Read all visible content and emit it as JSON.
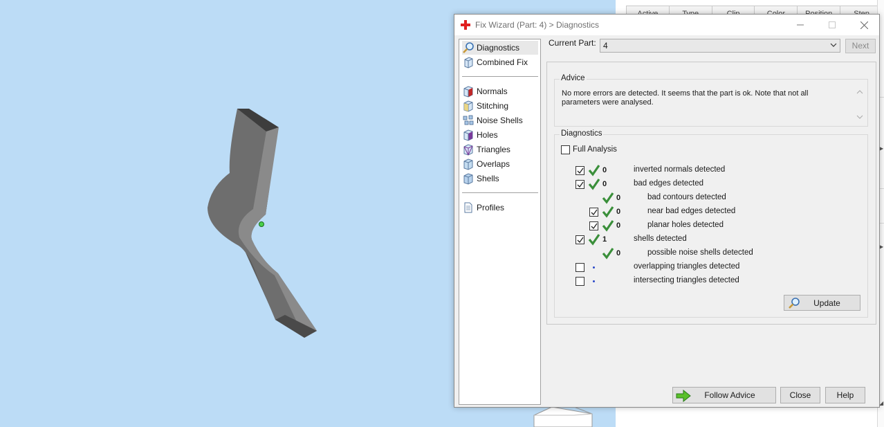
{
  "background_table": {
    "headers": [
      "Active",
      "Type",
      "Clip",
      "Color",
      "Position",
      "Step"
    ]
  },
  "dialog": {
    "title": "Fix Wizard (Part: 4) > Diagnostics"
  },
  "nav": {
    "items": [
      {
        "label": "Diagnostics",
        "icon": "magnifier-icon"
      },
      {
        "label": "Combined Fix",
        "icon": "cube-icon"
      },
      {
        "label": "Normals",
        "icon": "normals-cube-icon"
      },
      {
        "label": "Stitching",
        "icon": "stitching-cube-icon"
      },
      {
        "label": "Noise Shells",
        "icon": "noise-shells-icon"
      },
      {
        "label": "Holes",
        "icon": "holes-cube-icon"
      },
      {
        "label": "Triangles",
        "icon": "triangles-cube-icon"
      },
      {
        "label": "Overlaps",
        "icon": "overlaps-cube-icon"
      },
      {
        "label": "Shells",
        "icon": "shells-cube-icon"
      },
      {
        "label": "Profiles",
        "icon": "document-icon"
      }
    ]
  },
  "current_part": {
    "label": "Current Part:",
    "value": "4",
    "next_label": "Next"
  },
  "advice": {
    "title": "Advice",
    "text": "No more errors are detected. It seems that the part is ok. Note that not all parameters were analysed."
  },
  "diagnostics": {
    "title": "Diagnostics",
    "full_analysis_label": "Full Analysis",
    "full_analysis_checked": false,
    "rows": [
      {
        "count": "0",
        "label": "inverted normals detected",
        "checked": true,
        "status": "ok"
      },
      {
        "count": "0",
        "label": "bad edges detected",
        "checked": true,
        "status": "ok"
      },
      {
        "count": "0",
        "label": "bad contours detected",
        "checked": null,
        "status": "ok"
      },
      {
        "count": "0",
        "label": "near bad edges detected",
        "checked": true,
        "status": "ok"
      },
      {
        "count": "0",
        "label": "planar holes detected",
        "checked": true,
        "status": "ok"
      },
      {
        "count": "1",
        "label": "shells detected",
        "checked": true,
        "status": "ok"
      },
      {
        "count": "0",
        "label": "possible noise shells detected",
        "checked": null,
        "status": "ok"
      },
      {
        "count": "",
        "label": "overlapping triangles detected",
        "checked": false,
        "status": "pending"
      },
      {
        "count": "",
        "label": "intersecting triangles detected",
        "checked": false,
        "status": "pending"
      }
    ],
    "update_label": "Update"
  },
  "footer": {
    "follow_advice_label": "Follow Advice",
    "close_label": "Close",
    "help_label": "Help"
  },
  "colors": {
    "viewport_bg": "#bcdcf6",
    "check_green": "#3a8f3a",
    "pending_dot": "#2a48c8",
    "model_gray": "#6e6e6e"
  }
}
